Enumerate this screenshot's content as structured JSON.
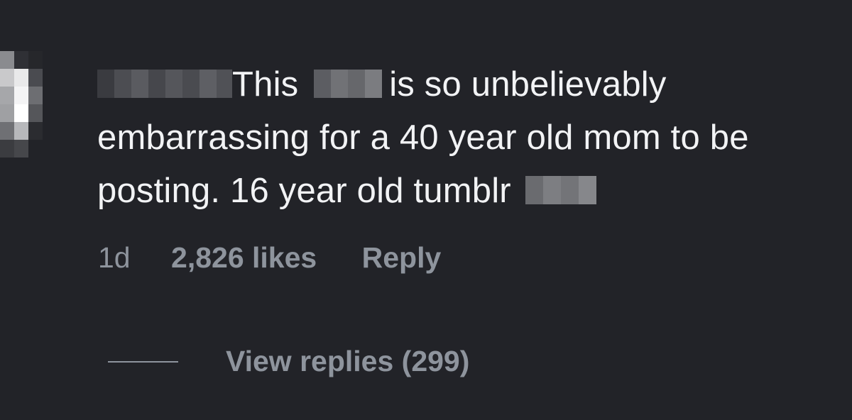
{
  "comment": {
    "text_part1": "This",
    "text_part2": "is so unbelievably",
    "line2": "embarrassing for a 40 year old mom to be",
    "line3": "posting. 16 year old tumblr"
  },
  "meta": {
    "time": "1d",
    "likes": "2,826 likes",
    "reply_label": "Reply"
  },
  "replies": {
    "view_label": "View replies (299)"
  },
  "colors": {
    "background": "#222328",
    "text_primary": "#f2f3f5",
    "text_secondary": "#8e949d"
  }
}
